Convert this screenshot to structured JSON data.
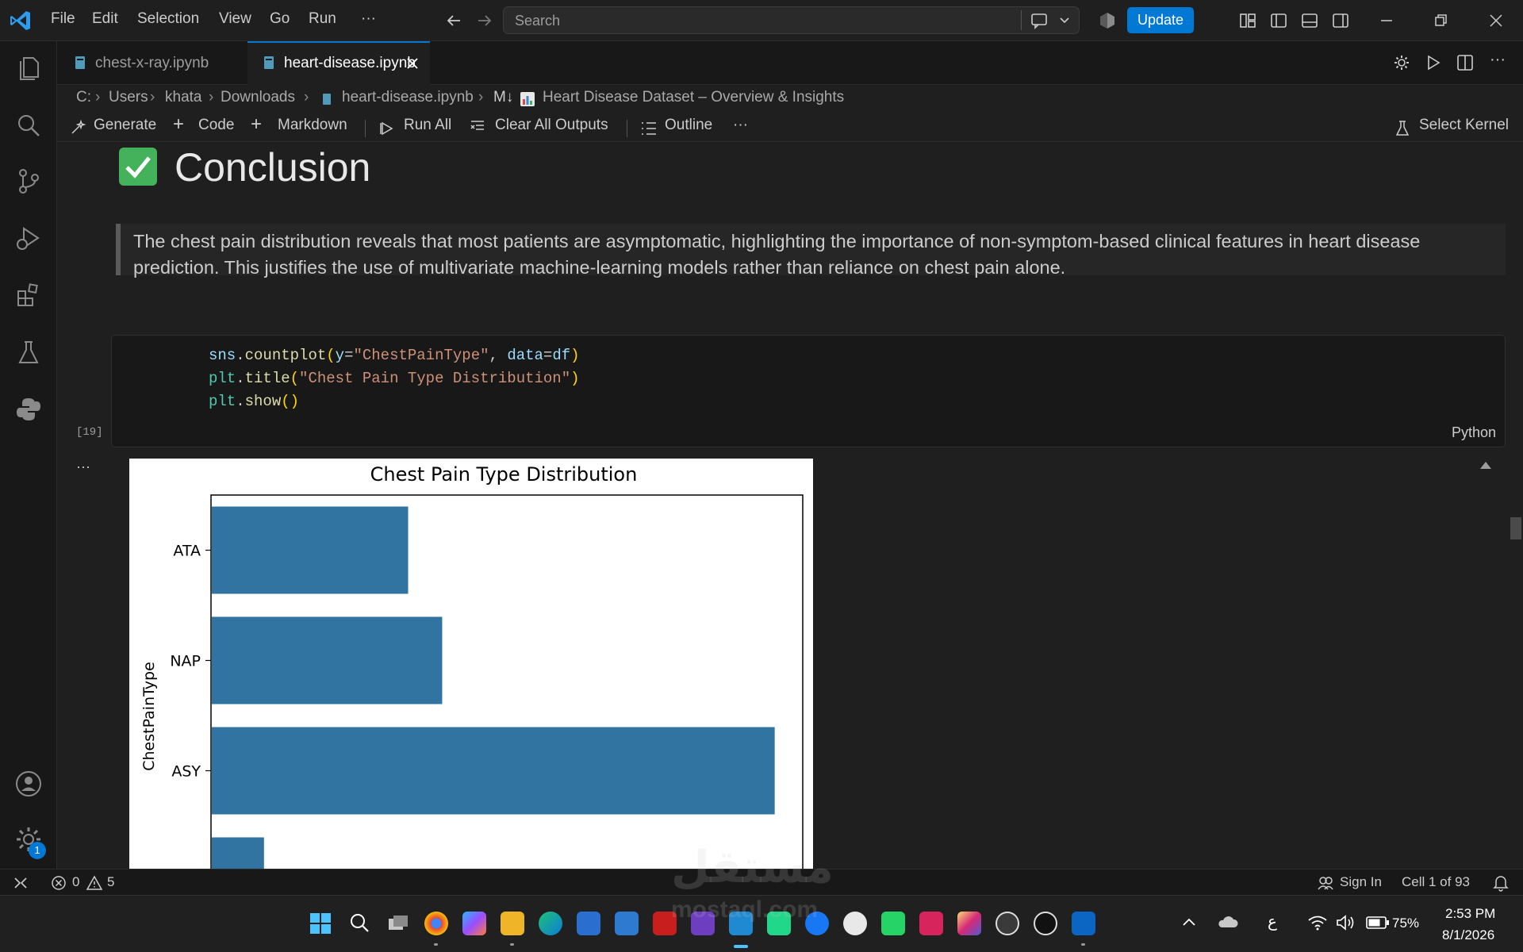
{
  "titlebar": {
    "menus": [
      "File",
      "Edit",
      "Selection",
      "View",
      "Go",
      "Run",
      "···"
    ],
    "search_placeholder": "Search",
    "update_label": "Update"
  },
  "tabs": [
    {
      "label": "chest-x-ray.ipynb",
      "active": false
    },
    {
      "label": "heart-disease.ipynb",
      "active": true
    }
  ],
  "breadcrumb": [
    "C:",
    "Users",
    "khata",
    "Downloads",
    "heart-disease.ipynb",
    "M↓",
    "Heart Disease Dataset – Overview & Insights"
  ],
  "toolbar": {
    "generate": "Generate",
    "code": "Code",
    "markdown": "Markdown",
    "run_all": "Run All",
    "clear_all": "Clear All Outputs",
    "outline": "Outline",
    "more": "···",
    "select_kernel": "Select Kernel"
  },
  "notebook": {
    "heading": "Conclusion",
    "blockquote": "The chest pain distribution reveals that most patients are asymptomatic, highlighting the importance of non-symptom-based clinical features in heart disease prediction. This justifies the use of multivariate machine-learning models rather than reliance on chest pain alone.",
    "execution_count": "[19]",
    "language": "Python",
    "output_menu": "···"
  },
  "chart_data": {
    "type": "bar",
    "orientation": "horizontal",
    "title": "Chest Pain Type Distribution",
    "ylabel": "ChestPainType",
    "xlabel": "",
    "categories": [
      "ATA",
      "NAP",
      "ASY",
      ""
    ],
    "values": [
      173,
      203,
      496,
      46
    ],
    "xlim": [
      0,
      520
    ],
    "bar_color": "#3274a1",
    "partially_visible": true
  },
  "statusbar": {
    "errors": "0",
    "warnings": "5",
    "sign_in": "Sign In",
    "cell_info": "Cell 1 of 93"
  },
  "activity_badge": "1",
  "taskbar": {
    "language": "ع",
    "battery": "75%",
    "time": "2:53 PM",
    "date": "8/1/2026"
  },
  "watermark": {
    "arabic": "مستقل",
    "latin": "mostaql.com"
  },
  "colors": {
    "accent": "#0078d4",
    "background": "#1f1f1f",
    "sidebar": "#181818"
  }
}
